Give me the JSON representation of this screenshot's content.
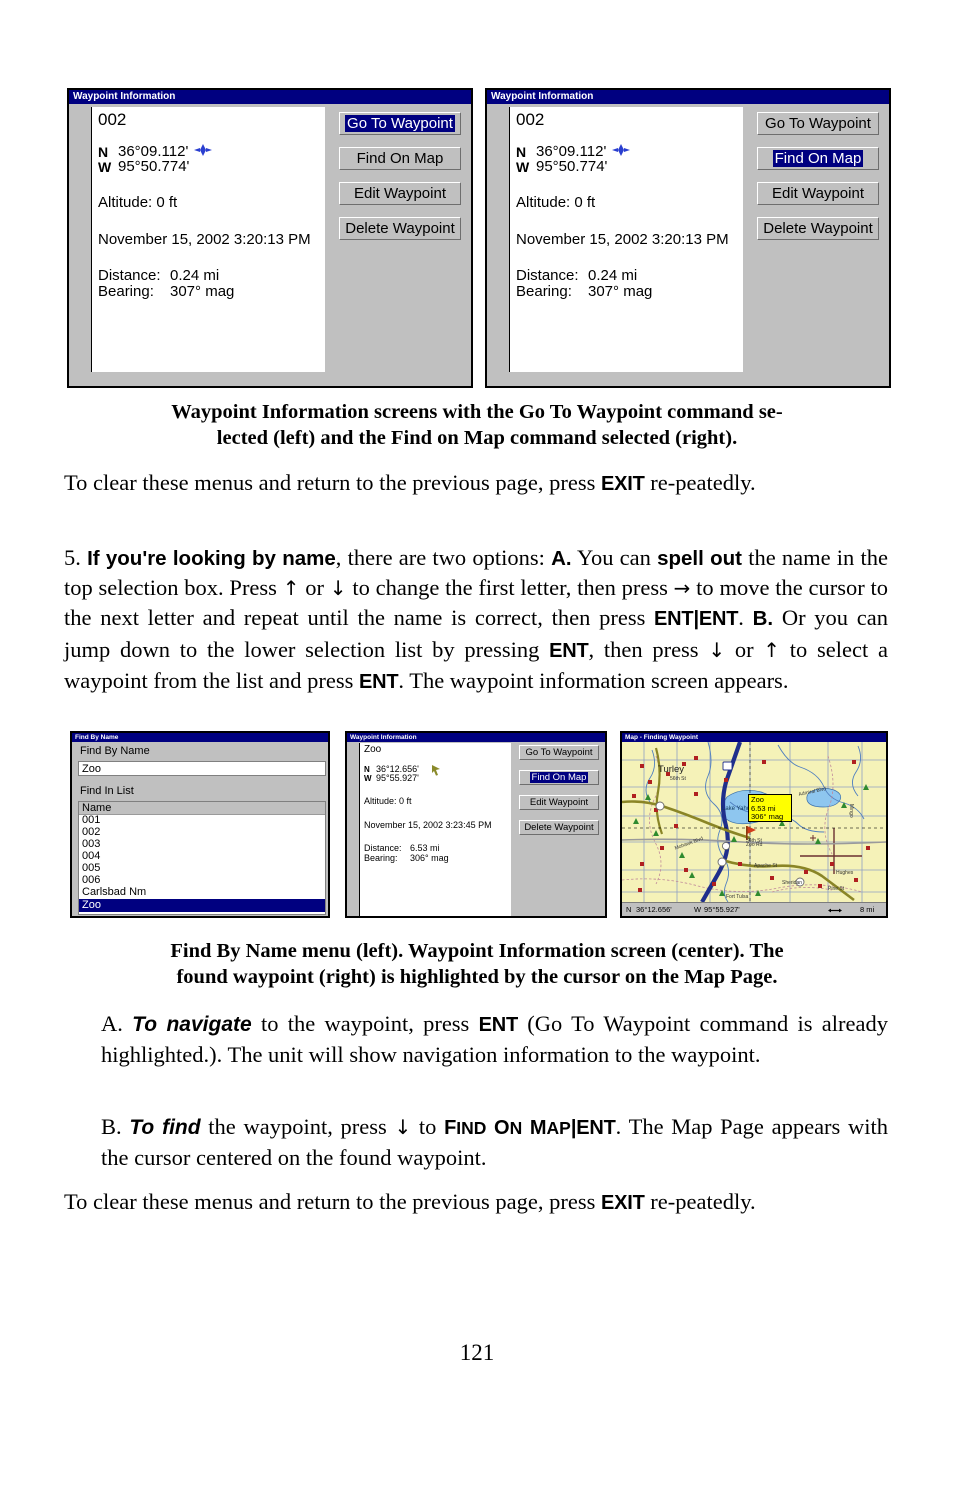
{
  "page": {
    "number": "121"
  },
  "figure_top": {
    "left_screen": {
      "title": "Waypoint Information",
      "waypoint_name": "002",
      "lat_prefix": "N",
      "lat": "36°09.112'",
      "lon_prefix": "W",
      "lon": "95°50.774'",
      "altitude": "Altitude: 0 ft",
      "timestamp": "November 15, 2002 3:20:13 PM",
      "distance_label": "Distance:",
      "distance_value": "0.24 mi",
      "bearing_label": "Bearing:",
      "bearing_value": "307° mag",
      "buttons": [
        {
          "label": "Go To Waypoint",
          "selected": true
        },
        {
          "label": "Find On Map",
          "selected": false
        },
        {
          "label": "Edit Waypoint",
          "selected": false
        },
        {
          "label": "Delete Waypoint",
          "selected": false
        }
      ]
    },
    "right_screen": {
      "title": "Waypoint Information",
      "waypoint_name": "002",
      "lat_prefix": "N",
      "lat": "36°09.112'",
      "lon_prefix": "W",
      "lon": "95°50.774'",
      "altitude": "Altitude: 0 ft",
      "timestamp": "November 15, 2002 3:20:13 PM",
      "distance_label": "Distance:",
      "distance_value": "0.24 mi",
      "bearing_label": "Bearing:",
      "bearing_value": "307° mag",
      "buttons": [
        {
          "label": "Go To Waypoint",
          "selected": false
        },
        {
          "label": "Find On Map",
          "selected": true
        },
        {
          "label": "Edit Waypoint",
          "selected": false
        },
        {
          "label": "Delete Waypoint",
          "selected": false
        }
      ]
    },
    "caption_line1": "Waypoint Information screens with the Go To Waypoint command se-",
    "caption_line2": "lected (left) and the Find on Map command selected (right)."
  },
  "para_clear_1": {
    "t1": "To clear these menus and return to the previous page, press ",
    "k1": "EXIT",
    "t2": " re-peatedly."
  },
  "step5": {
    "num": "5. ",
    "b1": "If you're looking by name",
    "t1": ", there are two options: ",
    "b2": "A.",
    "t2": " You can ",
    "b3": "spell out",
    "t3": " the name in the top selection box. Press ",
    "a1": "↑",
    "t4": " or ",
    "a2": "↓",
    "t5": " to change the first letter, then press ",
    "a3": "→",
    "t6": " to move the cursor to the next letter and repeat until the name is correct, then press ",
    "k1": "ENT",
    "bar1": "|",
    "k2": "ENT",
    "t7": ". ",
    "b4": "B.",
    "t8": " Or you can jump down to the lower selection list by pressing ",
    "k3": "ENT",
    "t9": ", then press ",
    "a4": "↓",
    "t10": " or ",
    "a5": "↑",
    "t11": " to select a waypoint from the list and press ",
    "k4": "ENT",
    "t12": ". The waypoint information screen appears."
  },
  "figure_mid": {
    "find_by_name": {
      "title": "Find By Name",
      "heading": "Find By Name",
      "input_value": "Zoo",
      "list_label": "Find In List",
      "column_header": "Name",
      "rows": [
        {
          "label": "001",
          "selected": false
        },
        {
          "label": "002",
          "selected": false
        },
        {
          "label": "003",
          "selected": false
        },
        {
          "label": "004",
          "selected": false
        },
        {
          "label": "005",
          "selected": false
        },
        {
          "label": "006",
          "selected": false
        },
        {
          "label": "Carlsbad Nm",
          "selected": false
        },
        {
          "label": "Zoo",
          "selected": true
        }
      ]
    },
    "waypoint_info": {
      "title": "Waypoint Information",
      "waypoint_name": "Zoo",
      "lat_prefix": "N",
      "lat": "36°12.656'",
      "lon_prefix": "W",
      "lon": "95°55.927'",
      "altitude": "Altitude: 0 ft",
      "timestamp": "November 15, 2002 3:23:45 PM",
      "distance_label": "Distance:",
      "distance_value": "6.53 mi",
      "bearing_label": "Bearing:",
      "bearing_value": "306° mag",
      "buttons": [
        {
          "label": "Go To Waypoint",
          "selected": false
        },
        {
          "label": "Find On Map",
          "selected": true
        },
        {
          "label": "Edit Waypoint",
          "selected": false
        },
        {
          "label": "Delete Waypoint",
          "selected": false
        }
      ]
    },
    "map_page": {
      "title": "Map - Finding Waypoint",
      "callout": {
        "name": "Zoo",
        "distance": "6.53 mi",
        "bearing": "306° mag"
      },
      "place_labels": [
        "Turley",
        "Lake Yahola",
        "36th St",
        "56th St",
        "Apache St",
        "Pine St",
        "Zoo Rd",
        "Mingo",
        "Admiral Blvd",
        "Mohawk Blvd",
        "Fort Tulsa",
        "Sheridan",
        "Hughes"
      ],
      "status": {
        "lat_prefix": "N",
        "lat": "36°12.656'",
        "lon_prefix": "W",
        "lon": "95°55.927'",
        "scale": "8 mi"
      }
    },
    "caption_line1": "Find By Name menu (left). Waypoint Information screen (center). The",
    "caption_line2": "found waypoint (right) is highlighted by the cursor on the Map Page."
  },
  "item_a": {
    "lead": "A. ",
    "bi": "To navigate",
    "t1": " to the waypoint, press ",
    "k1": "ENT",
    "t2": " (Go To Waypoint command is already highlighted.). The unit will show navigation information to the waypoint."
  },
  "item_b": {
    "lead": "B. ",
    "bi": "To find",
    "t1": " the waypoint, press ",
    "a1": "↓",
    "t2": " to ",
    "sc1": "F",
    "sc1r": "IND",
    "sc2": " O",
    "sc2r": "N",
    "sc3": " M",
    "sc3r": "AP",
    "bar": "|",
    "k1": "ENT",
    "t3": ". The Map Page appears with the cursor centered on the found waypoint."
  },
  "para_clear_2": {
    "t1": "To clear these menus and return to the previous page, press ",
    "k1": "EXIT",
    "t2": " re-peatedly."
  }
}
